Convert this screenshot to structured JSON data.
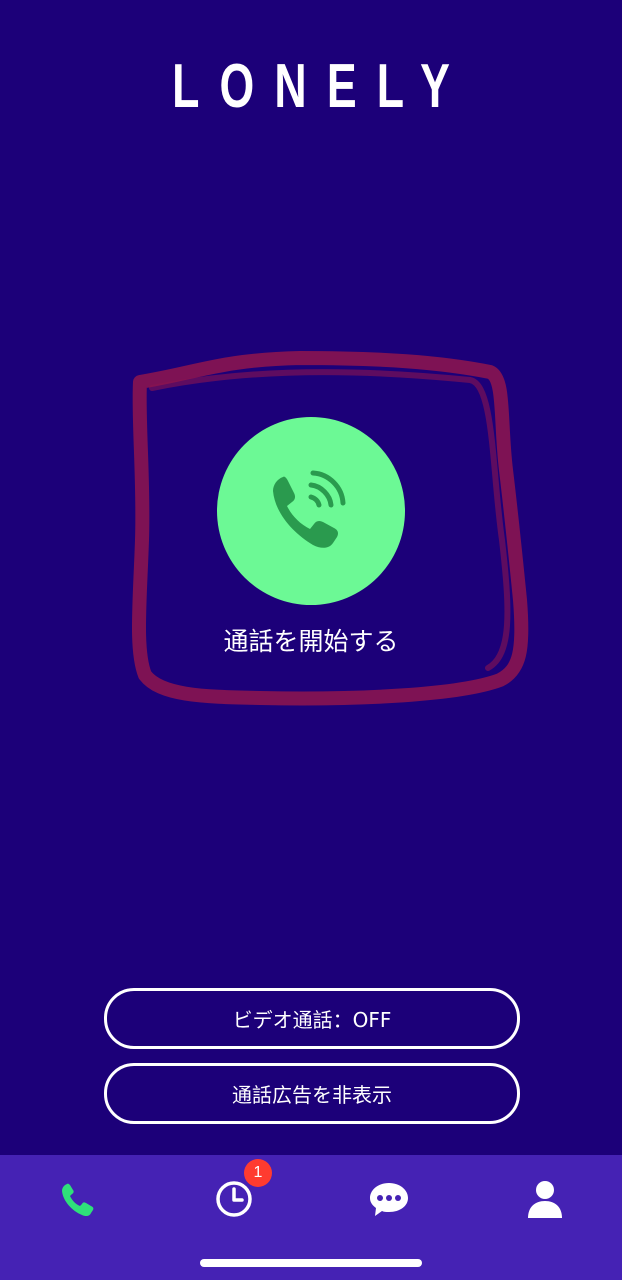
{
  "app": {
    "title": "LONELY"
  },
  "main": {
    "call_button_icon": "phone-ringing-icon",
    "call_label": "通話を開始する"
  },
  "actions": {
    "video_call_label": "ビデオ通話：OFF",
    "hide_ads_label": "通話広告を非表示"
  },
  "tab_bar": {
    "items": [
      {
        "name": "call",
        "icon": "phone-icon",
        "active": true
      },
      {
        "name": "history",
        "icon": "clock-icon",
        "badge": "1"
      },
      {
        "name": "chat",
        "icon": "chat-bubble-icon"
      },
      {
        "name": "profile",
        "icon": "person-icon"
      }
    ]
  },
  "colors": {
    "background": "#1c0079",
    "tab_bar": "#4522b4",
    "call_button": "#6cf995",
    "call_icon": "#2a9a4e",
    "active_tab": "#2fe07a",
    "badge": "#ff3b30",
    "annotation_mark": "#8a1450"
  }
}
